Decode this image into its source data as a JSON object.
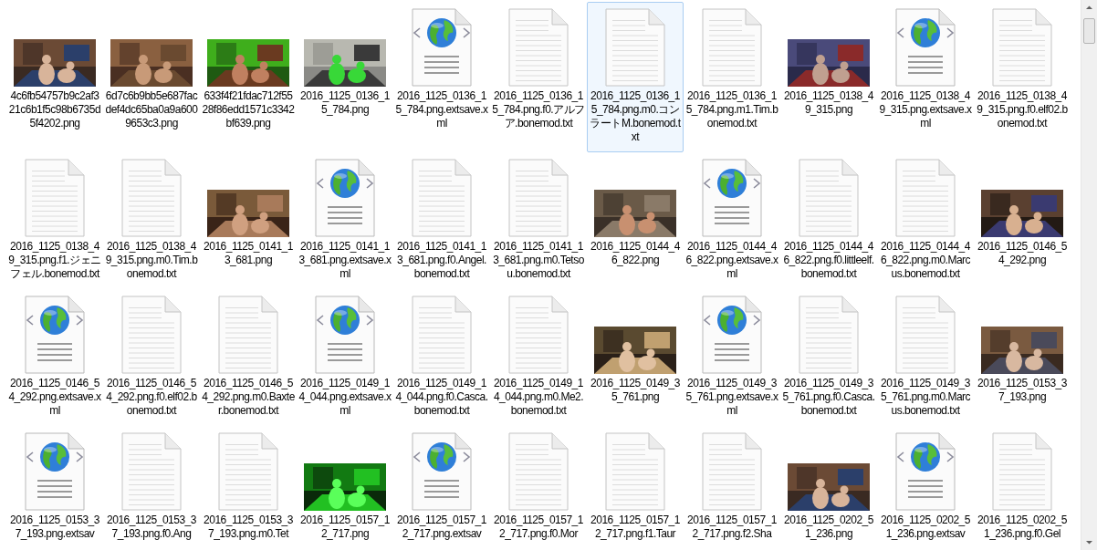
{
  "items": [
    {
      "kind": "picture",
      "name": "4c6fb54757b9c2af321c6b1f5c98b6735d5f4202.png",
      "selected": false
    },
    {
      "kind": "picture",
      "name": "6d7c6b9bb5e687facdef4dc65ba0a9a6009653c3.png",
      "selected": false
    },
    {
      "kind": "picture",
      "name": "633f4f21fdac712f5528f86edd1571c3342bf639.png",
      "selected": false
    },
    {
      "kind": "picture",
      "name": "2016_1125_0136_15_784.png",
      "selected": false
    },
    {
      "kind": "xml",
      "name": "2016_1125_0136_15_784.png.extsave.xml",
      "selected": false
    },
    {
      "kind": "txt",
      "name": "2016_1125_0136_15_784.png.f0.アルフア.bonemod.txt",
      "selected": false
    },
    {
      "kind": "txt",
      "name": "2016_1125_0136_15_784.png.m0.コンラートM.bonemod.txt",
      "selected": true
    },
    {
      "kind": "txt",
      "name": "2016_1125_0136_15_784.png.m1.Tim.bonemod.txt",
      "selected": false
    },
    {
      "kind": "picture",
      "name": "2016_1125_0138_49_315.png",
      "selected": false
    },
    {
      "kind": "xml",
      "name": "2016_1125_0138_49_315.png.extsave.xml",
      "selected": false
    },
    {
      "kind": "txt",
      "name": "2016_1125_0138_49_315.png.f0.elf02.bonemod.txt",
      "selected": false
    },
    {
      "kind": "txt",
      "name": "2016_1125_0138_49_315.png.f1.ジェニフェル.bonemod.txt",
      "selected": false
    },
    {
      "kind": "txt",
      "name": "2016_1125_0138_49_315.png.m0.Tim.bonemod.txt",
      "selected": false
    },
    {
      "kind": "picture",
      "name": "2016_1125_0141_13_681.png",
      "selected": false
    },
    {
      "kind": "xml",
      "name": "2016_1125_0141_13_681.png.extsave.xml",
      "selected": false
    },
    {
      "kind": "txt",
      "name": "2016_1125_0141_13_681.png.f0.Angel.bonemod.txt",
      "selected": false
    },
    {
      "kind": "txt",
      "name": "2016_1125_0141_13_681.png.m0.Tetsou.bonemod.txt",
      "selected": false
    },
    {
      "kind": "picture",
      "name": "2016_1125_0144_46_822.png",
      "selected": false
    },
    {
      "kind": "xml",
      "name": "2016_1125_0144_46_822.png.extsave.xml",
      "selected": false
    },
    {
      "kind": "txt",
      "name": "2016_1125_0144_46_822.png.f0.littleelf.bonemod.txt",
      "selected": false
    },
    {
      "kind": "txt",
      "name": "2016_1125_0144_46_822.png.m0.Marcus.bonemod.txt",
      "selected": false
    },
    {
      "kind": "picture",
      "name": "2016_1125_0146_54_292.png",
      "selected": false
    },
    {
      "kind": "xml",
      "name": "2016_1125_0146_54_292.png.extsave.xml",
      "selected": false
    },
    {
      "kind": "txt",
      "name": "2016_1125_0146_54_292.png.f0.elf02.bonemod.txt",
      "selected": false
    },
    {
      "kind": "txt",
      "name": "2016_1125_0146_54_292.png.m0.Baxter.bonemod.txt",
      "selected": false
    },
    {
      "kind": "xml",
      "name": "2016_1125_0149_14_044.png.extsave.xml",
      "selected": false
    },
    {
      "kind": "txt",
      "name": "2016_1125_0149_14_044.png.f0.Casca.bonemod.txt",
      "selected": false
    },
    {
      "kind": "txt",
      "name": "2016_1125_0149_14_044.png.m0.Me2.bonemod.txt",
      "selected": false
    },
    {
      "kind": "picture",
      "name": "2016_1125_0149_35_761.png",
      "selected": false
    },
    {
      "kind": "xml",
      "name": "2016_1125_0149_35_761.png.extsave.xml",
      "selected": false
    },
    {
      "kind": "txt",
      "name": "2016_1125_0149_35_761.png.f0.Casca.bonemod.txt",
      "selected": false
    },
    {
      "kind": "txt",
      "name": "2016_1125_0149_35_761.png.m0.Marcus.bonemod.txt",
      "selected": false
    },
    {
      "kind": "picture",
      "name": "2016_1125_0153_37_193.png",
      "selected": false
    },
    {
      "kind": "xml",
      "name": "2016_1125_0153_37_193.png.extsav",
      "selected": false
    },
    {
      "kind": "txt",
      "name": "2016_1125_0153_37_193.png.f0.Ang",
      "selected": false
    },
    {
      "kind": "txt",
      "name": "2016_1125_0153_37_193.png.m0.Tet",
      "selected": false
    },
    {
      "kind": "picture",
      "name": "2016_1125_0157_12_717.png",
      "selected": false
    },
    {
      "kind": "xml",
      "name": "2016_1125_0157_12_717.png.extsav",
      "selected": false
    },
    {
      "kind": "txt",
      "name": "2016_1125_0157_12_717.png.f0.Mor",
      "selected": false
    },
    {
      "kind": "txt",
      "name": "2016_1125_0157_12_717.png.f1.Taur",
      "selected": false
    },
    {
      "kind": "txt",
      "name": "2016_1125_0157_12_717.png.f2.Sha",
      "selected": false
    },
    {
      "kind": "picture",
      "name": "2016_1125_0202_51_236.png",
      "selected": false
    },
    {
      "kind": "xml",
      "name": "2016_1125_0202_51_236.png.extsav",
      "selected": false
    },
    {
      "kind": "txt",
      "name": "2016_1125_0202_51_236.png.f0.Gel",
      "selected": false
    }
  ]
}
